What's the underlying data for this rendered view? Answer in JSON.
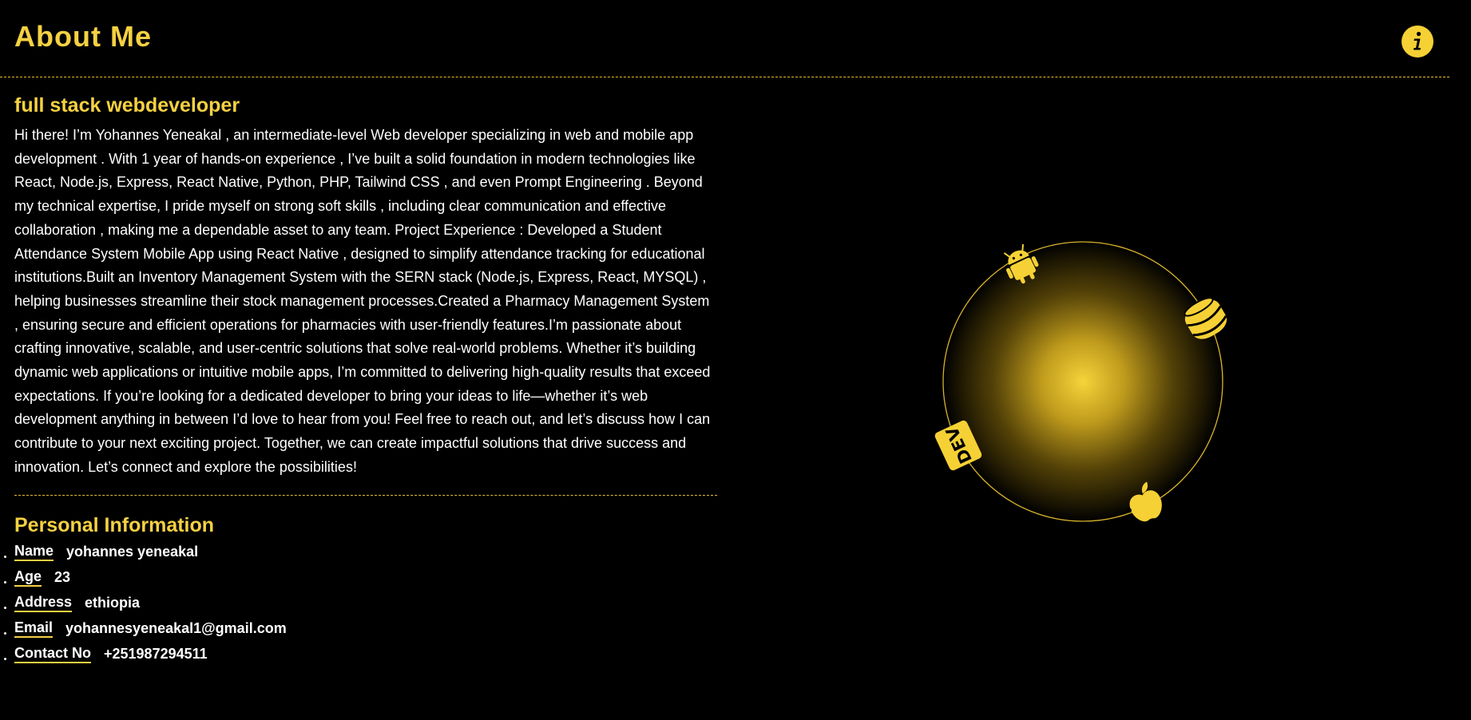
{
  "header": {
    "title": "About Me",
    "info_icon": "info-icon"
  },
  "intro": {
    "subtitle": "full stack webdeveloper",
    "bio": "Hi there! I’m Yohannes Yeneakal , an intermediate-level Web developer specializing in web and mobile app development . With 1 year of hands-on experience , I’ve built a solid foundation in modern technologies like React, Node.js, Express, React Native, Python, PHP, Tailwind CSS , and even Prompt Engineering . Beyond my technical expertise, I pride myself on strong soft skills , including clear communication and effective collaboration , making me a dependable asset to any team. Project Experience : Developed a Student Attendance System Mobile App using React Native , designed to simplify attendance tracking for educational institutions.Built an Inventory Management System with the SERN stack (Node.js, Express, React, MYSQL) , helping businesses streamline their stock management processes.Created a Pharmacy Management System , ensuring secure and efficient operations for pharmacies with user-friendly features.I’m passionate about crafting innovative, scalable, and user-centric solutions that solve real-world problems. Whether it’s building dynamic web applications or intuitive mobile apps, I’m committed to delivering high-quality results that exceed expectations. If you’re looking for a dedicated developer to bring your ideas to life—whether it’s web development anything in between I’d love to hear from you! Feel free to reach out, and let’s discuss how I can contribute to your next exciting project. Together, we can create impactful solutions that drive success and innovation. Let’s connect and explore the possibilities!"
  },
  "personal_info": {
    "title": "Personal Information",
    "items": [
      {
        "label": "Name",
        "value": "yohannes yeneakal"
      },
      {
        "label": "Age",
        "value": "23"
      },
      {
        "label": "Address",
        "value": "ethiopia"
      },
      {
        "label": "Email",
        "value": "yohannesyeneakal1@gmail.com"
      },
      {
        "label": "Contact No",
        "value": "+251987294511"
      }
    ]
  },
  "orbit": {
    "icons": [
      "android-icon",
      "database-icon",
      "dev-icon",
      "apple-icon"
    ],
    "dev_badge_text": "DEV"
  },
  "colors": {
    "accent": "#f5d142",
    "background": "#000000",
    "text": "#ffffff"
  }
}
